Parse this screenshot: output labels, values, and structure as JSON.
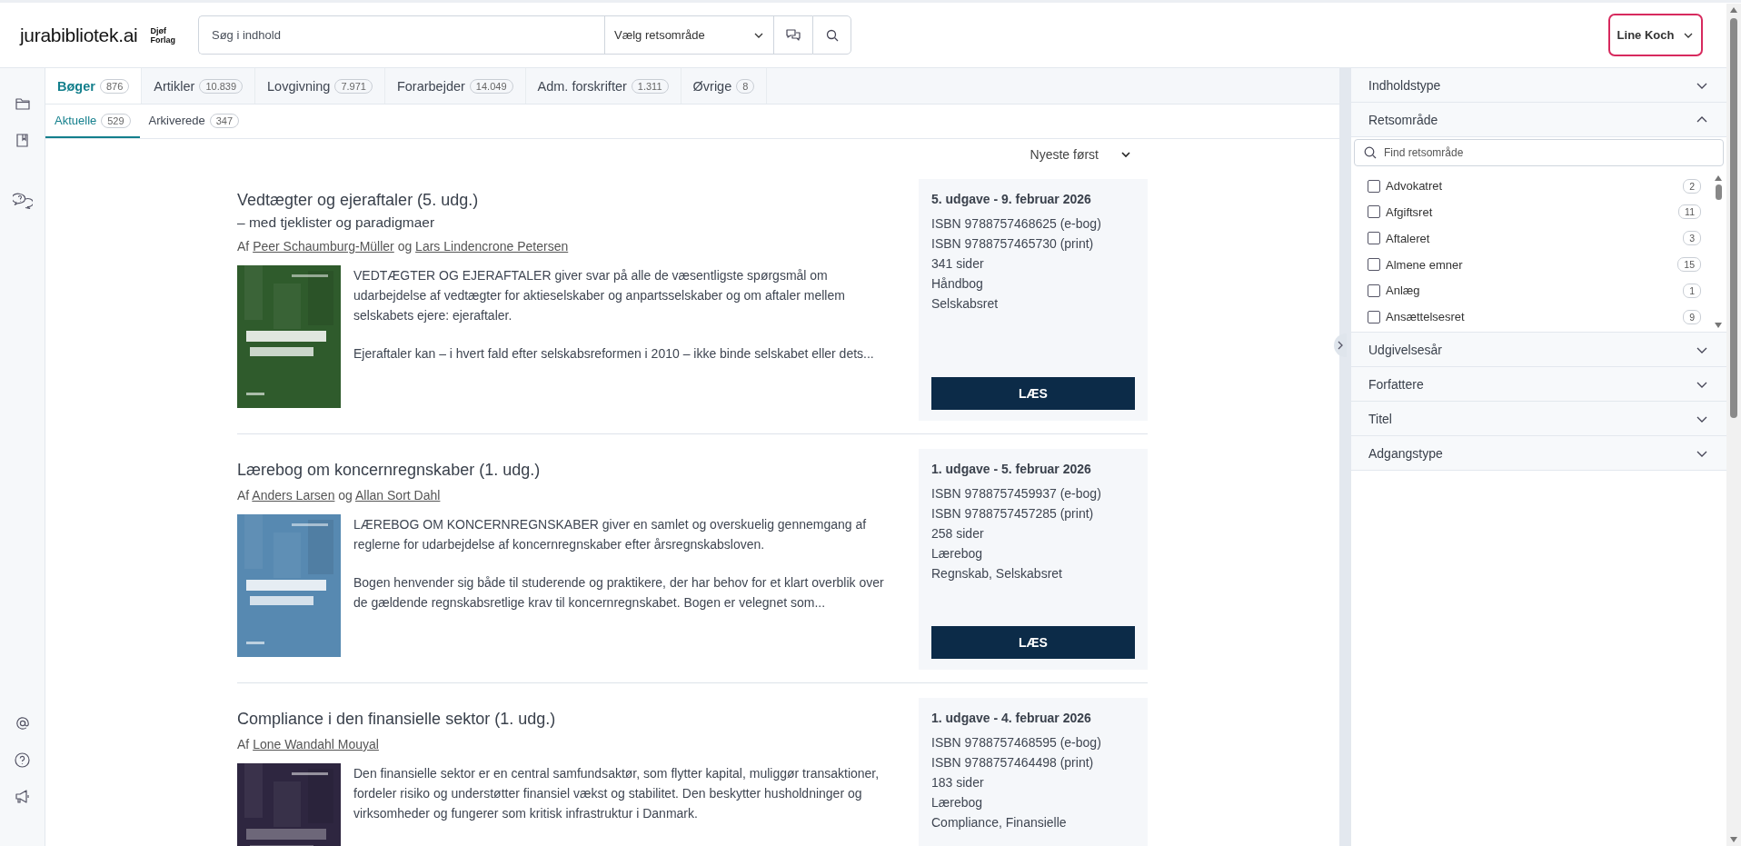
{
  "header": {
    "logo": "jurabibliotek.ai",
    "publisher": [
      "Djøf",
      "Forlag"
    ],
    "search": {
      "placeholder": "Søg i indhold"
    },
    "area_select": {
      "value": "Vælg retsområde"
    },
    "user": {
      "name": "Line Koch"
    }
  },
  "tabs": [
    {
      "label": "Bøger",
      "count": "876",
      "selected": true
    },
    {
      "label": "Artikler",
      "count": "10.839",
      "selected": false
    },
    {
      "label": "Lovgivning",
      "count": "7.971",
      "selected": false
    },
    {
      "label": "Forarbejder",
      "count": "14.049",
      "selected": false
    },
    {
      "label": "Adm. forskrifter",
      "count": "1.311",
      "selected": false
    },
    {
      "label": "Øvrige",
      "count": "8",
      "selected": false
    }
  ],
  "subtabs": [
    {
      "label": "Aktuelle",
      "count": "529",
      "selected": true
    },
    {
      "label": "Arkiverede",
      "count": "347",
      "selected": false
    }
  ],
  "sort": {
    "value": "Nyeste først"
  },
  "books": [
    {
      "title": "Vedtægter og ejeraftaler (5. udg.)",
      "subtitle": "– med tjeklister og paradigmaer",
      "byline_prefix": "Af",
      "joiner": "og",
      "authors": [
        "Peer Schaumburg-Müller",
        "Lars Lindencrone Petersen"
      ],
      "cover": {
        "kind": "picture"
      },
      "description": [
        "VEDTÆGTER OG EJERAFTALER giver svar på alle de væsentligste spørgsmål om udarbejdelse af vedtægter for aktieselskaber og anpartsselskaber og om aftaler mellem selskabets ejere: ejeraftaler.",
        "Ejeraftaler kan – i hvert fald efter selskabsreformen i 2010 – ikke binde selskabet eller dets..."
      ],
      "edition": "5. udgave - 9. februar 2026",
      "details": [
        "ISBN 9788757468625 (e-bog)",
        "ISBN 9788757465730 (print)",
        "341 sider",
        "Håndbog",
        "Selskabsret"
      ],
      "button": "LÆS"
    },
    {
      "title": "Lærebog om koncernregnskaber (1. udg.)",
      "byline_prefix": "Af",
      "joiner": "og",
      "authors": [
        "Anders Larsen",
        "Allan Sort Dahl"
      ],
      "cover": {
        "kind": "picture"
      },
      "description": [
        "LÆREBOG OM KONCERNREGNSKABER giver en samlet og overskuelig gennemgang af reglerne for udarbejdelse af koncernregnskaber efter årsregnskabsloven.",
        "Bogen henvender sig både til studerende og praktikere, der har behov for et klart overblik over de gældende regnskabsretlige krav til koncernregnskabet. Bogen er velegnet som..."
      ],
      "edition": "1. udgave - 5. februar 2026",
      "details": [
        "ISBN 9788757459937 (e-bog)",
        "ISBN 9788757457285 (print)",
        "258 sider",
        "Lærebog",
        "Regnskab, Selskabsret"
      ],
      "button": "LÆS"
    },
    {
      "title": "Compliance i den finansielle sektor (1. udg.)",
      "byline_prefix": "Af",
      "authors": [
        "Lone Wandahl Mouyal"
      ],
      "cover": {
        "kind": "picture"
      },
      "description": [
        "Den finansielle sektor er en central samfundsaktør, som flytter kapital, muliggør transaktioner, fordeler risiko og understøtter finansiel vækst og stabilitet. Den beskytter husholdninger og virksomheder og fungerer som kritisk infrastruktur i Danmark."
      ],
      "edition": "1. udgave - 4. februar 2026",
      "details": [
        "ISBN 9788757468595 (e-bog)",
        "ISBN 9788757464498 (print)",
        "183 sider",
        "Lærebog",
        "Compliance, Finansielle"
      ]
    }
  ],
  "filters": [
    {
      "label": "Indholdstype",
      "expanded": false
    },
    {
      "label": "Retsområde",
      "expanded": true,
      "search": {
        "placeholder": "Find retsområde"
      },
      "options": [
        {
          "label": "Advokatret",
          "count": "2",
          "checked": false
        },
        {
          "label": "Afgiftsret",
          "count": "11",
          "checked": false
        },
        {
          "label": "Aftaleret",
          "count": "3",
          "checked": false
        },
        {
          "label": "Almene emner",
          "count": "15",
          "checked": false
        },
        {
          "label": "Anlæg",
          "count": "1",
          "checked": false
        },
        {
          "label": "Ansættelsesret",
          "count": "9",
          "checked": false
        }
      ]
    },
    {
      "label": "Udgivelsesår",
      "expanded": false
    },
    {
      "label": "Forfattere",
      "expanded": false
    },
    {
      "label": "Titel",
      "expanded": false
    },
    {
      "label": "Adgangstype",
      "expanded": false
    }
  ]
}
